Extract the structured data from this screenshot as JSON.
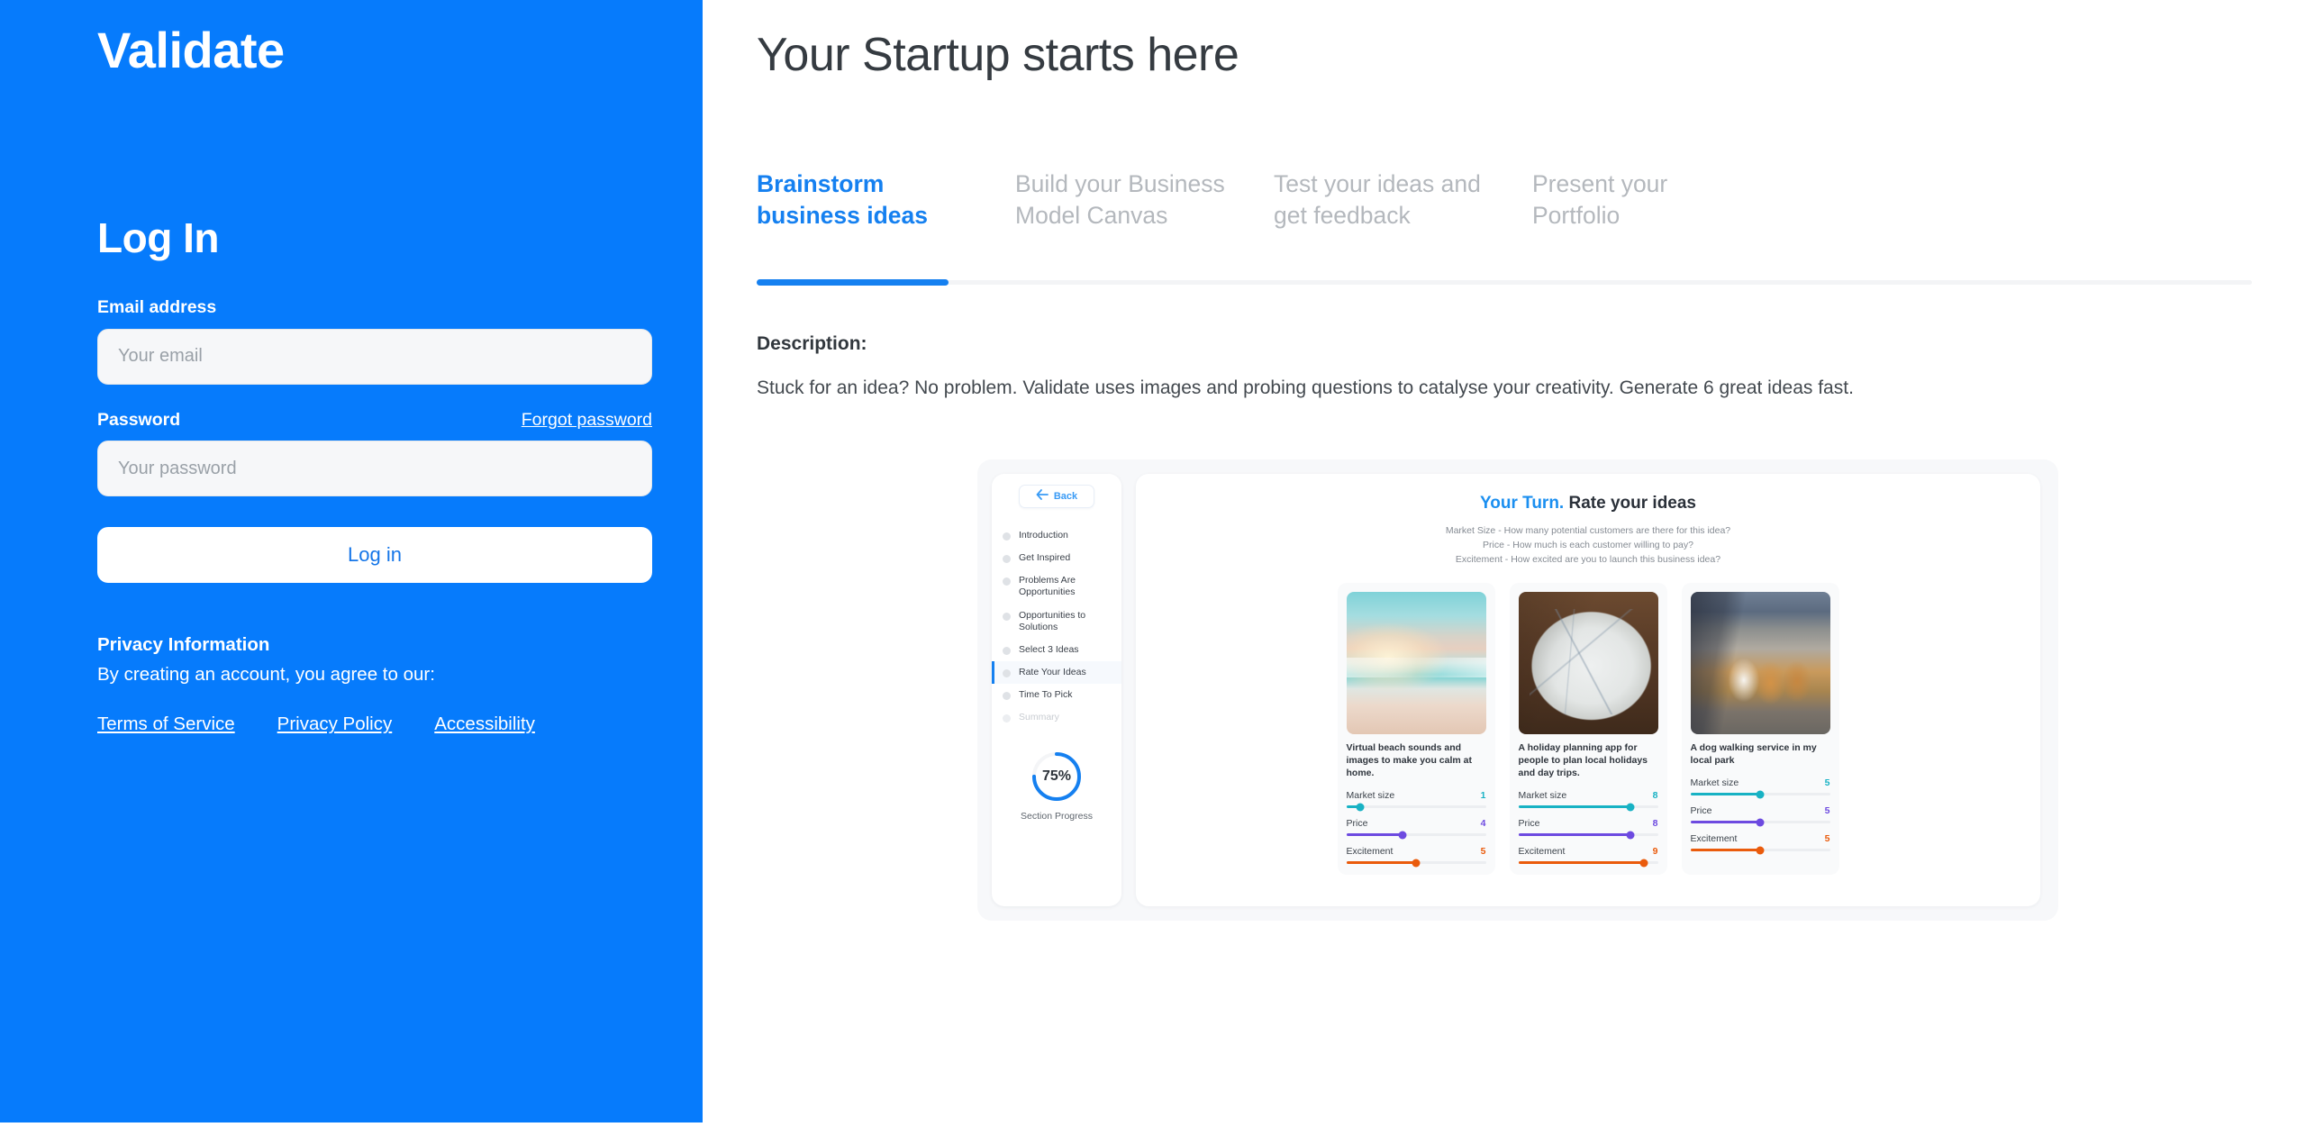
{
  "auth": {
    "brand": "Validate",
    "title": "Log In",
    "email_label": "Email address",
    "email_placeholder": "Your email",
    "email_value": "",
    "password_label": "Password",
    "password_placeholder": "Your password",
    "password_value": "",
    "forgot_label": "Forgot password",
    "login_label": "Log in",
    "privacy_heading": "Privacy Information",
    "privacy_text": "By creating an account, you agree to our:",
    "links": [
      {
        "label": "Terms of Service"
      },
      {
        "label": "Privacy Policy"
      },
      {
        "label": "Accessibility"
      }
    ],
    "accent_bg": "#067bfc",
    "button_text_color": "#1676e8"
  },
  "main": {
    "page_title": "Your Startup starts here",
    "tabs": [
      {
        "line1": "Brainstorm",
        "line2": "business ideas",
        "active": true
      },
      {
        "line1": "Build your Business",
        "line2": "Model Canvas",
        "active": false
      },
      {
        "line1": "Test your ideas and",
        "line2": "get feedback",
        "active": false
      },
      {
        "line1": "Present your",
        "line2": "Portfolio",
        "active": false
      }
    ],
    "active_tab_color": "#1580f0",
    "description_label": "Description:",
    "description_body": "Stuck for an idea? No problem. Validate uses images and probing questions to catalyse your creativity. Generate 6 great ideas fast."
  },
  "preview": {
    "back_label": "Back",
    "steps": [
      {
        "label": "Introduction",
        "state": "default"
      },
      {
        "label": "Get Inspired",
        "state": "default"
      },
      {
        "label": "Problems Are Opportunities",
        "state": "default"
      },
      {
        "label": "Opportunities to Solutions",
        "state": "default"
      },
      {
        "label": "Select 3 Ideas",
        "state": "default"
      },
      {
        "label": "Rate Your Ideas",
        "state": "current"
      },
      {
        "label": "Time To Pick",
        "state": "default"
      },
      {
        "label": "Summary",
        "state": "muted"
      }
    ],
    "progress": {
      "percent_label": "75%",
      "percent_value": 75,
      "caption": "Section Progress",
      "color": "#1580f0"
    },
    "heading_accent": "Your Turn.",
    "heading_rest": " Rate your ideas",
    "questions": [
      "Market Size - How many potential customers are there for this idea?",
      "Price - How much is each customer willing to pay?",
      "Excitement - How excited are you to launch this business idea?"
    ],
    "slider_colors": {
      "market": "#18b2c4",
      "price": "#6d4ae0",
      "excitement": "#ea5b0c"
    },
    "slider_max": 10,
    "ideas": [
      {
        "art": "art-beach",
        "caption": "Virtual beach sounds and images to make you calm at home.",
        "ratings": [
          {
            "name": "Market size",
            "value": 1
          },
          {
            "name": "Price",
            "value": 4
          },
          {
            "name": "Excitement",
            "value": 5
          }
        ]
      },
      {
        "art": "art-map",
        "caption": "A holiday planning app for people to plan local holidays and day trips.",
        "ratings": [
          {
            "name": "Market size",
            "value": 8
          },
          {
            "name": "Price",
            "value": 8
          },
          {
            "name": "Excitement",
            "value": 9
          }
        ]
      },
      {
        "art": "art-dogs",
        "caption": "A dog walking service in my local park",
        "ratings": [
          {
            "name": "Market size",
            "value": 5
          },
          {
            "name": "Price",
            "value": 5
          },
          {
            "name": "Excitement",
            "value": 5
          }
        ]
      }
    ]
  }
}
